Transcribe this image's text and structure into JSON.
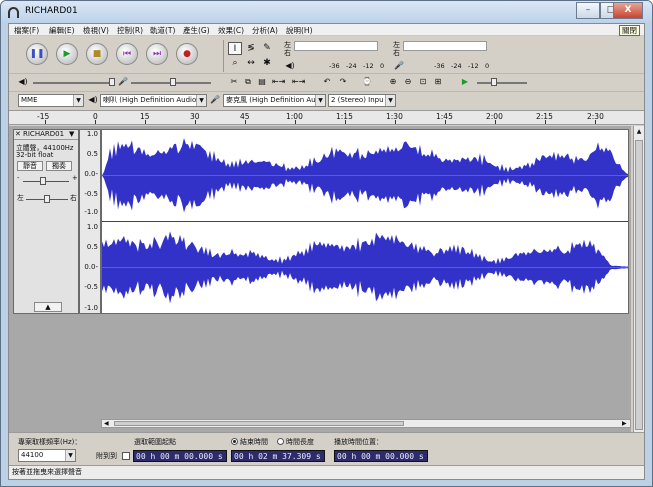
{
  "window": {
    "title": "RICHARD01",
    "minimize": "–",
    "maximize": "□",
    "close": "X"
  },
  "menu": [
    "檔案(F)",
    "編輯(E)",
    "檢視(V)",
    "控制(R)",
    "軌道(T)",
    "產生(G)",
    "效果(C)",
    "分析(A)",
    "說明(H)"
  ],
  "tooltip": "關閉",
  "transport": {
    "pause": "❚❚",
    "play": "▶",
    "stop": "■",
    "skip_start": "⏮",
    "skip_end": "⏭",
    "record": "●"
  },
  "tools": {
    "select": "I",
    "envelope": "≶",
    "draw": "✎",
    "zoom": "⌕",
    "timeshift": "↔",
    "multi": "✱"
  },
  "meters": {
    "out_left": "左",
    "out_right": "右",
    "in_left": "左",
    "in_right": "右",
    "ticks": [
      "-36",
      "-24",
      "-12",
      "0"
    ],
    "speaker_icon": "speaker-icon",
    "mic_icon": "microphone-icon"
  },
  "edit_toolbar": [
    "✂",
    "⧉",
    "▤",
    "⇤⇥",
    "↶",
    "↷",
    "⌚",
    "⊕",
    "⊖",
    "⊡",
    "⊞",
    "▶"
  ],
  "devices": {
    "host": "MME",
    "output": "喇叭 (High Definition Audio",
    "input": "麥克風 (High Definition Au",
    "channels": "2 (Stereo) Inpu"
  },
  "ruler": {
    "ticks": [
      "-15",
      "0",
      "15",
      "30",
      "45",
      "1:00",
      "1:15",
      "1:30",
      "1:45",
      "2:00",
      "2:15",
      "2:30"
    ]
  },
  "track": {
    "name": "RICHARD01",
    "info1": "立體聲，44100Hz",
    "info2": "32-bit float",
    "mute": "靜音",
    "solo": "獨奏",
    "gain_minus": "-",
    "gain_plus": "+",
    "pan_l": "左",
    "pan_r": "右",
    "collapse": "▲",
    "amp_labels": [
      "1.0",
      "0.5",
      "0.0-",
      "-0.5",
      "-1.0"
    ]
  },
  "selection": {
    "rate_label": "專案取樣頻率(Hz)：",
    "rate_value": "44100",
    "snap_label": "附到到",
    "sel_start_label": "選取範圍起點",
    "end_label": "結束時間",
    "length_label": "時間長度",
    "audio_pos_label": "播放時間位置：",
    "sel_start": "00 h 00 m 00.000 s",
    "sel_end": "00 h 02 m 37.309 s",
    "audio_pos": "00 h 00 m 00.000 s"
  },
  "status": "按著並拖曳來選擇聲音"
}
